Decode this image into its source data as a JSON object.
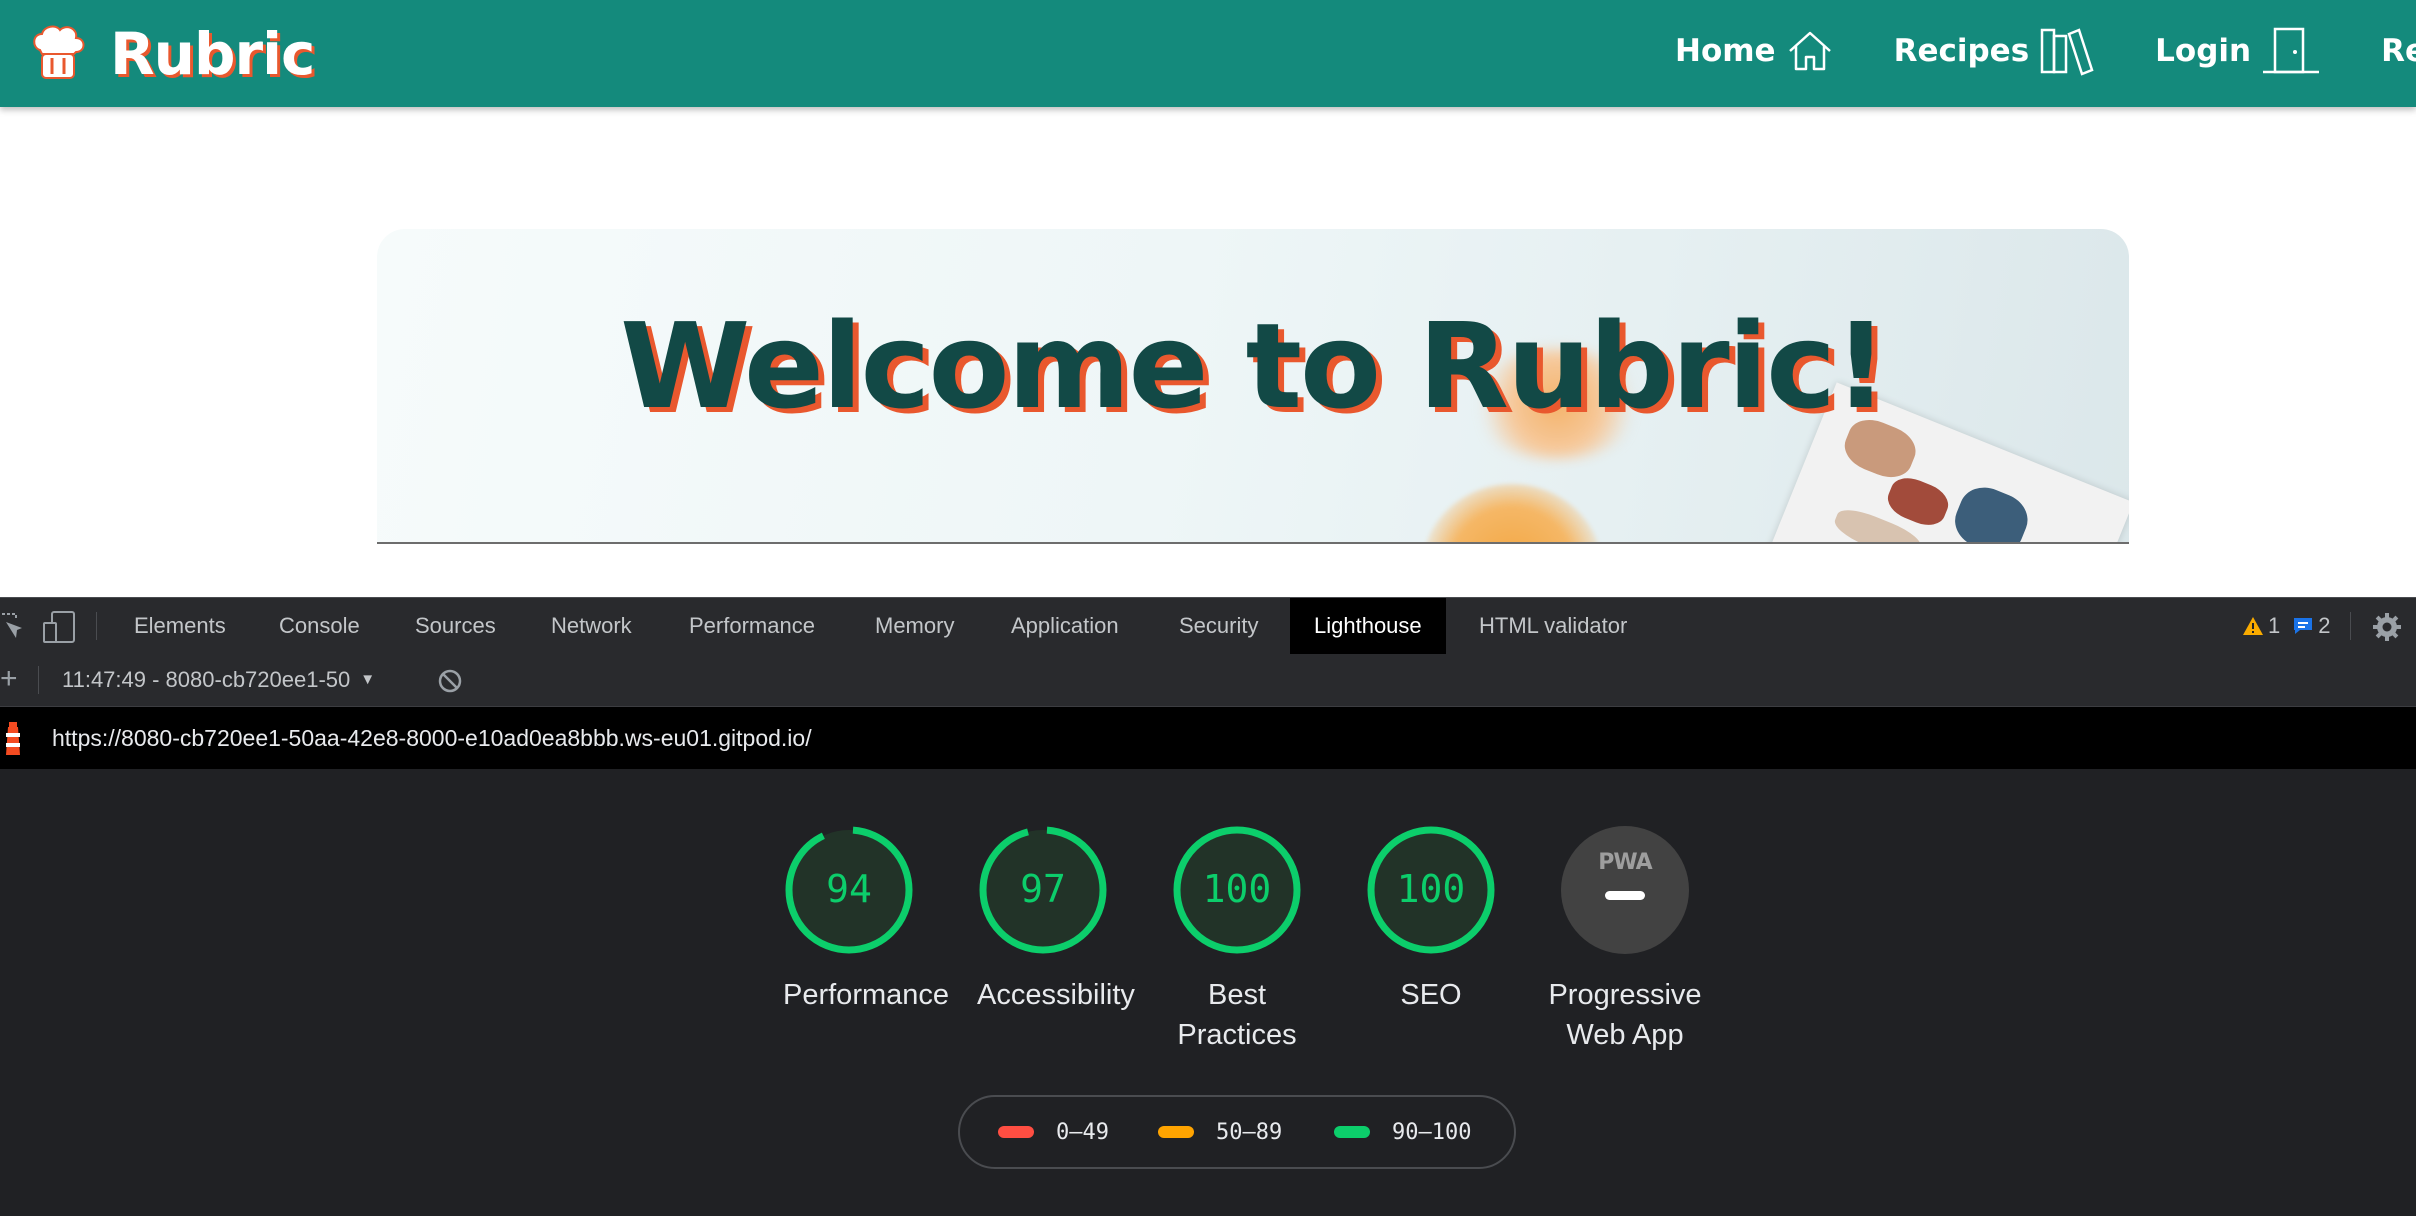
{
  "site": {
    "brand": "Rubric",
    "nav": [
      {
        "label": "Home",
        "icon": "house-icon"
      },
      {
        "label": "Recipes",
        "icon": "books-icon"
      },
      {
        "label": "Login",
        "icon": "door-icon"
      },
      {
        "label": "Registe",
        "icon": ""
      }
    ],
    "hero_title": "Welcome to Rubric!",
    "colors": {
      "navbar": "#148a7c",
      "title": "#124946",
      "title_shadow": "#e9582e"
    }
  },
  "devtools": {
    "tabs": [
      "Elements",
      "Console",
      "Sources",
      "Network",
      "Performance",
      "Memory",
      "Application",
      "Security",
      "Lighthouse",
      "HTML validator"
    ],
    "active_tab": "Lighthouse",
    "warnings_count": "1",
    "messages_count": "2",
    "report_selector": "11:47:49 - 8080-cb720ee1-50",
    "report_url": "https://8080-cb720ee1-50aa-42e8-8000-e10ad0ea8bbb.ws-eu01.gitpod.io/",
    "scores": [
      {
        "score": "94",
        "fraction": 0.94,
        "label": "Performance"
      },
      {
        "score": "97",
        "fraction": 0.97,
        "label": "Accessibility"
      },
      {
        "score": "100",
        "fraction": 1.0,
        "label": "Best Practices"
      },
      {
        "score": "100",
        "fraction": 1.0,
        "label": "SEO"
      }
    ],
    "pwa": {
      "badge": "PWA",
      "label": "Progressive Web App"
    },
    "legend": [
      {
        "range": "0–49",
        "color": "#ff4e42"
      },
      {
        "range": "50–89",
        "color": "#ffa400"
      },
      {
        "range": "90–100",
        "color": "#0cce6b"
      }
    ]
  }
}
